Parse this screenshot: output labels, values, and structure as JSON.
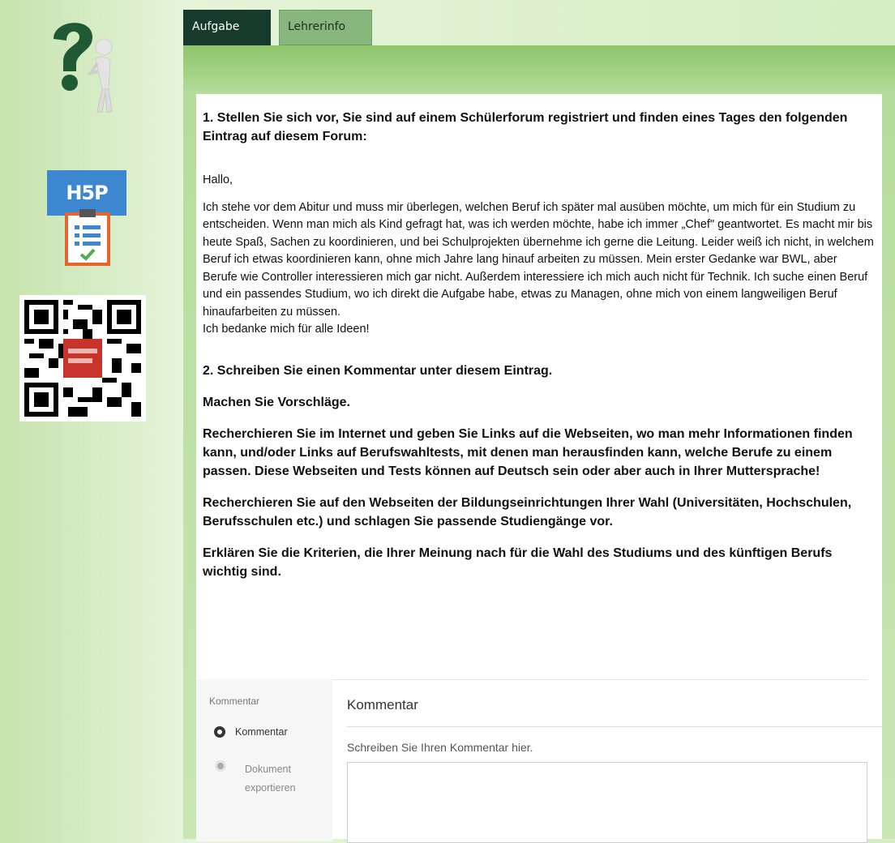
{
  "tabs": {
    "task": "Aufgabe",
    "teacher": "Lehrerinfo"
  },
  "left_rail": {
    "h5p_badge": "H5P"
  },
  "task": {
    "heading1": "1. Stellen Sie sich vor, Sie sind auf einem Schülerforum registriert und finden eines Tages den folgenden Eintrag auf diesem Forum:",
    "greeting": "Hallo,",
    "post": "Ich stehe vor dem Abitur und muss mir überlegen, welchen Beruf ich später mal ausüben möchte, um mich für ein Studium zu entscheiden. Wenn man mich als Kind gefragt hat, was ich werden möchte, habe ich immer „Chef\" geantwortet. Es macht mir bis heute Spaß, Sachen zu koordinieren, und bei Schulprojekten übernehme ich gerne die Leitung. Leider weiß ich nicht, in welchem Beruf ich etwas koordinieren kann, ohne mich Jahre lang hinauf arbeiten zu müssen. Mein erster Gedanke war BWL, aber Berufe wie Controller interessieren mich gar nicht. Außerdem interessiere ich mich auch nicht für Technik. Ich suche einen Beruf und ein passendes Studium, wo ich direkt die Aufgabe habe, etwas zu Managen, ohne mich von einem langweiligen Beruf hinaufarbeiten zu müssen.",
    "thanks": "Ich bedanke mich für alle Ideen!",
    "heading2": "2. Schreiben Sie einen Kommentar unter diesem Eintrag.",
    "suggest": "Machen Sie Vorschläge.",
    "research_links": "Recherchieren Sie im Internet und geben Sie Links auf die Webseiten, wo man mehr Informationen finden kann, und/oder Links auf Berufswahltests, mit denen man herausfinden kann, welche Berufe zu einem passen. Diese Webseiten und Tests können auf Deutsch sein oder aber auch in Ihrer Muttersprache!",
    "research_schools": "Recherchieren Sie auf den Webseiten der Bildungseinrichtungen Ihrer Wahl (Universitäten, Hochschulen, Berufsschulen etc.) und schlagen Sie passende Studiengänge vor.",
    "criteria": "Erklären Sie die Kriterien, die Ihrer Meinung nach für die Wahl des Studiums und des künftigen Berufs wichtig sind."
  },
  "comment": {
    "side_label": "Kommentar",
    "step1": "Kommentar",
    "step2": "Dokument exportieren",
    "heading": "Kommentar",
    "hint": "Schreiben Sie Ihren Kommentar hier."
  },
  "colors": {
    "tab_active": "#163a2b",
    "tab_inactive": "#88b77e",
    "h5p_blue": "#3c87cf",
    "clipboard_orange": "#e8642c"
  }
}
